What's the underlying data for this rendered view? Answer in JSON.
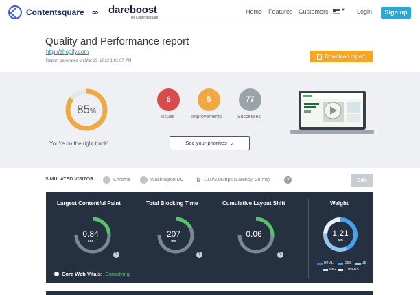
{
  "header": {
    "brand": "Contentsquare",
    "product": "dareboost",
    "product_sub": "by Contentsquare",
    "nav": [
      "Home",
      "Features",
      "Customers"
    ],
    "login": "Login",
    "signup": "Sign up"
  },
  "report": {
    "title": "Quality and Performance report",
    "url": "http://shopify.com",
    "generated": "Report generated on Mar 29, 2022 1:01:07 PM",
    "download": "Download report"
  },
  "summary": {
    "score": 85,
    "score_display": "85",
    "score_unit": "%",
    "message": "You're on the right track!",
    "issues": {
      "count": "6",
      "label": "Issues",
      "color": "#d94a4a"
    },
    "improvements": {
      "count": "5",
      "label": "Improvements",
      "color": "#f0a843"
    },
    "successes": {
      "count": "77",
      "label": "Successes",
      "color": "#9aa3a8"
    },
    "priorities_button": "See your priorities"
  },
  "visitor": {
    "label": "SIMULATED VISITOR:",
    "browser": "Chrome",
    "location": "Washington DC",
    "connection": "10.0/2.0Mbps (Latency: 28 ms)",
    "edit": "Edit"
  },
  "metrics": {
    "lcp": {
      "title": "Largest Contentful Paint",
      "value": "0.84",
      "unit": "sec"
    },
    "tbt": {
      "title": "Total Blocking Time",
      "value": "207",
      "unit": "ms"
    },
    "cls": {
      "title": "Cumulative Layout Shift",
      "value": "0.06",
      "unit": ""
    },
    "weight": {
      "title": "Weight",
      "value": "1.21",
      "unit": "MB"
    },
    "core_web_vitals_label": "Core Web Vitals:",
    "core_web_vitals_status": "Complying",
    "weight_legend": [
      "HTML",
      "CSS",
      "JS",
      "IMG",
      "OTHERS"
    ]
  },
  "colors": {
    "accent": "#29a9d8",
    "download": "#f5a623",
    "panel": "#253141",
    "good": "#57c26a",
    "score_ring": "#f0a843"
  }
}
